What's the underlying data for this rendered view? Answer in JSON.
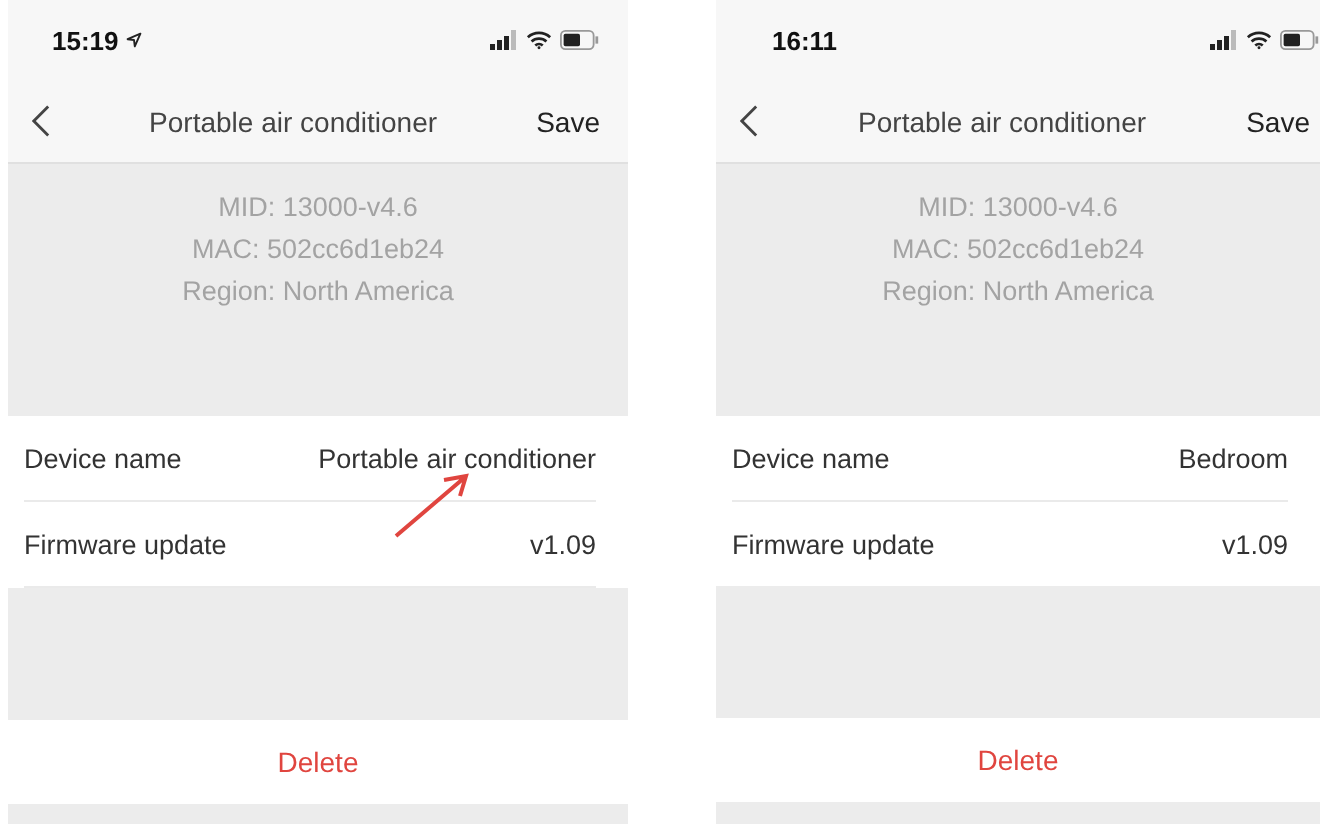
{
  "screens": [
    {
      "status_bar": {
        "time": "15:19",
        "location": true
      },
      "nav": {
        "title": "Portable air conditioner",
        "action": "Save"
      },
      "info": [
        "MID: 13000-v4.6",
        "MAC: 502cc6d1eb24",
        "Region: North America"
      ],
      "rows": [
        {
          "label": "Device name",
          "value": "Portable air conditioner",
          "pointer_arrow": true
        },
        {
          "label": "Firmware update",
          "value": "v1.09",
          "pointer_arrow": false
        }
      ],
      "delete": "Delete"
    },
    {
      "status_bar": {
        "time": "16:11"
      },
      "nav": {
        "title": "Portable air conditioner",
        "action": "Save"
      },
      "info": [
        "MID: 13000-v4.6",
        "MAC: 502cc6d1eb24",
        "Region: North America"
      ],
      "rows": [
        {
          "label": "Device name",
          "value": "Bedroom",
          "pointer_arrow": false
        },
        {
          "label": "Firmware update",
          "value": "v1.09",
          "pointer_arrow": false
        }
      ],
      "delete": "Delete"
    }
  ]
}
